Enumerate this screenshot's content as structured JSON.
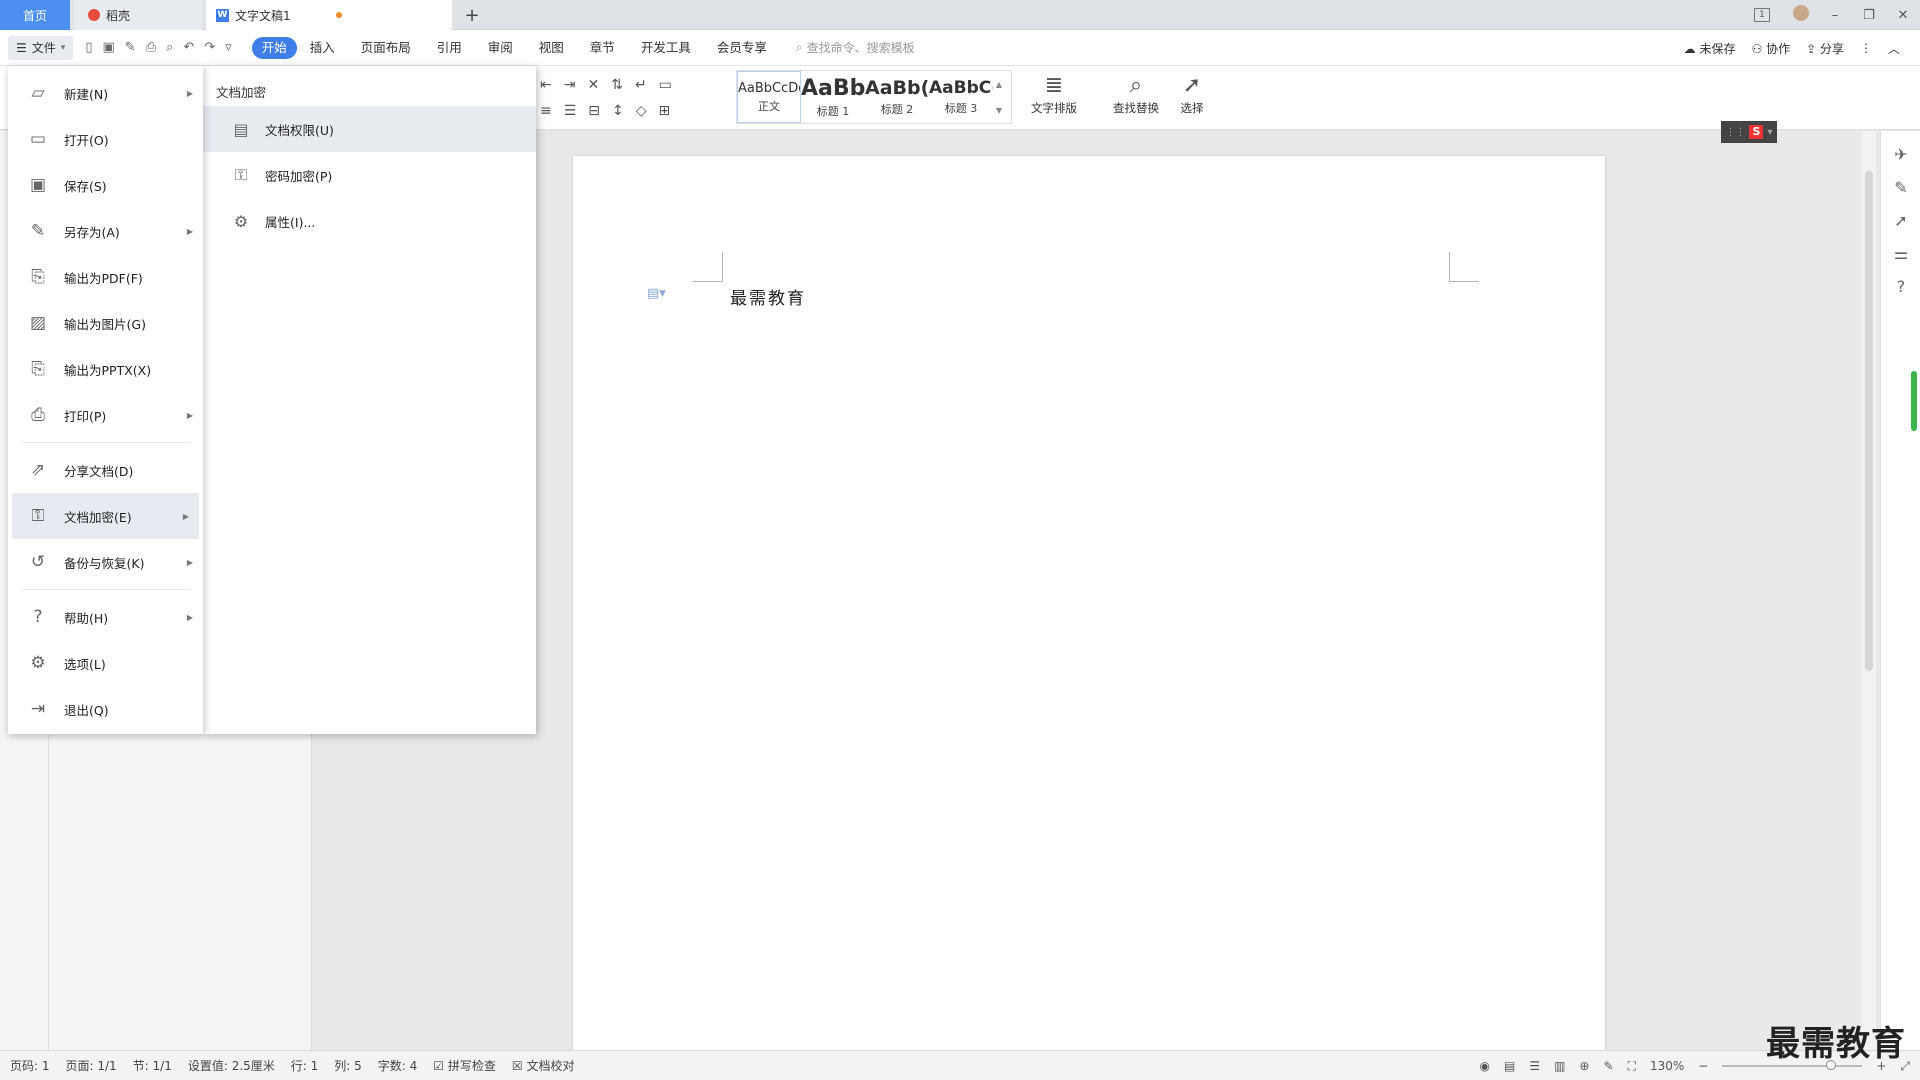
{
  "tabs": {
    "home": "首页",
    "daoke": "稻壳",
    "doc": "文字文稿1",
    "add": "+"
  },
  "window": {
    "page_indicator": "1",
    "minimize": "–",
    "restore": "❐",
    "close": "✕"
  },
  "menubar": {
    "file": "文件",
    "ribbon_tabs": [
      "开始",
      "插入",
      "页面布局",
      "引用",
      "审阅",
      "视图",
      "章节",
      "开发工具",
      "会员专享"
    ],
    "search_placeholder": "查找命令、搜索模板",
    "unsaved": "未保存",
    "collab": "协作",
    "share": "分享"
  },
  "ribbon": {
    "styles": [
      {
        "preview": "AaBbCcDd",
        "label": "正文"
      },
      {
        "preview": "AaBb",
        "label": "标题 1"
      },
      {
        "preview": "AaBb(",
        "label": "标题 2"
      },
      {
        "preview": "AaBbC(",
        "label": "标题 3"
      }
    ],
    "text_layout": "文字排版",
    "find_replace": "查找替换",
    "select": "选择"
  },
  "file_menu": {
    "items": [
      {
        "label": "新建(N)",
        "icon": "new-doc-icon",
        "arrow": true
      },
      {
        "label": "打开(O)",
        "icon": "folder-icon",
        "arrow": false
      },
      {
        "label": "保存(S)",
        "icon": "save-icon",
        "arrow": false
      },
      {
        "label": "另存为(A)",
        "icon": "save-as-icon",
        "arrow": true
      },
      {
        "label": "输出为PDF(F)",
        "icon": "pdf-icon",
        "arrow": false
      },
      {
        "label": "输出为图片(G)",
        "icon": "image-icon",
        "arrow": false
      },
      {
        "label": "输出为PPTX(X)",
        "icon": "pptx-icon",
        "arrow": false
      },
      {
        "label": "打印(P)",
        "icon": "print-icon",
        "arrow": true
      },
      {
        "label": "分享文档(D)",
        "icon": "share-icon",
        "arrow": false
      },
      {
        "label": "文档加密(E)",
        "icon": "encrypt-icon",
        "arrow": true
      },
      {
        "label": "备份与恢复(K)",
        "icon": "backup-icon",
        "arrow": true
      },
      {
        "label": "帮助(H)",
        "icon": "help-icon",
        "arrow": true
      },
      {
        "label": "选项(L)",
        "icon": "gear-icon",
        "arrow": false
      },
      {
        "label": "退出(Q)",
        "icon": "exit-icon",
        "arrow": false
      }
    ]
  },
  "submenu": {
    "title": "文档加密",
    "items": [
      {
        "label": "文档权限(U)",
        "icon": "doc-permission-icon"
      },
      {
        "label": "密码加密(P)",
        "icon": "password-lock-icon"
      },
      {
        "label": "属性(I)...",
        "icon": "properties-icon"
      }
    ]
  },
  "document": {
    "text": "最需教育"
  },
  "statusbar": {
    "page_no": "页码: 1",
    "pages": "页面: 1/1",
    "section": "节: 1/1",
    "setting": "设置值: 2.5厘米",
    "row": "行: 1",
    "col": "列: 5",
    "words": "字数: 4",
    "spell_check": "拼写检查",
    "doc_proof": "文档校对",
    "zoom": "130%"
  },
  "watermark": "最需教育",
  "colors": {
    "accent": "#3f7ee8",
    "home_tab": "#4d8ff0",
    "unsaved_dot": "#f08a24",
    "ime_s": "#e33333"
  }
}
